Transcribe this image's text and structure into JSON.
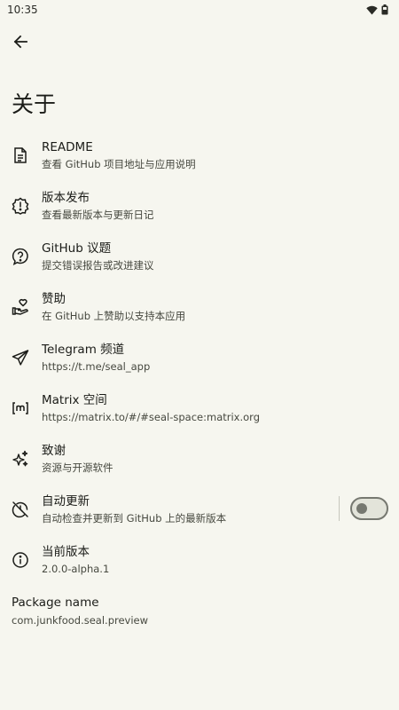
{
  "status_bar": {
    "time": "10:35",
    "icons": [
      "wifi-icon",
      "battery-icon"
    ]
  },
  "header": {
    "back_icon": "arrow-back-icon",
    "title": "关于"
  },
  "items": [
    {
      "icon": "document-icon",
      "title": "README",
      "subtitle": "查看 GitHub 项目地址与应用说明"
    },
    {
      "icon": "new-release-icon",
      "title": "版本发布",
      "subtitle": "查看最新版本与更新日记"
    },
    {
      "icon": "help-bubble-icon",
      "title": "GitHub 议题",
      "subtitle": "提交错误报告或改进建议"
    },
    {
      "icon": "volunteer-hand-icon",
      "title": "赞助",
      "subtitle": "在 GitHub 上赞助以支持本应用"
    },
    {
      "icon": "telegram-send-icon",
      "title": "Telegram 频道",
      "subtitle": "https://t.me/seal_app"
    },
    {
      "icon": "matrix-icon",
      "title": "Matrix 空间",
      "subtitle": "https://matrix.to/#/#seal-space:matrix.org"
    },
    {
      "icon": "sparkle-icon",
      "title": "致谢",
      "subtitle": "资源与开源软件"
    },
    {
      "icon": "update-disabled-icon",
      "title": "自动更新",
      "subtitle": "自动检查并更新到 GitHub 上的最新版本",
      "toggle": false
    },
    {
      "icon": "info-icon",
      "title": "当前版本",
      "subtitle": "2.0.0-alpha.1"
    }
  ],
  "package": {
    "title": "Package name",
    "value": "com.junkfood.seal.preview"
  }
}
